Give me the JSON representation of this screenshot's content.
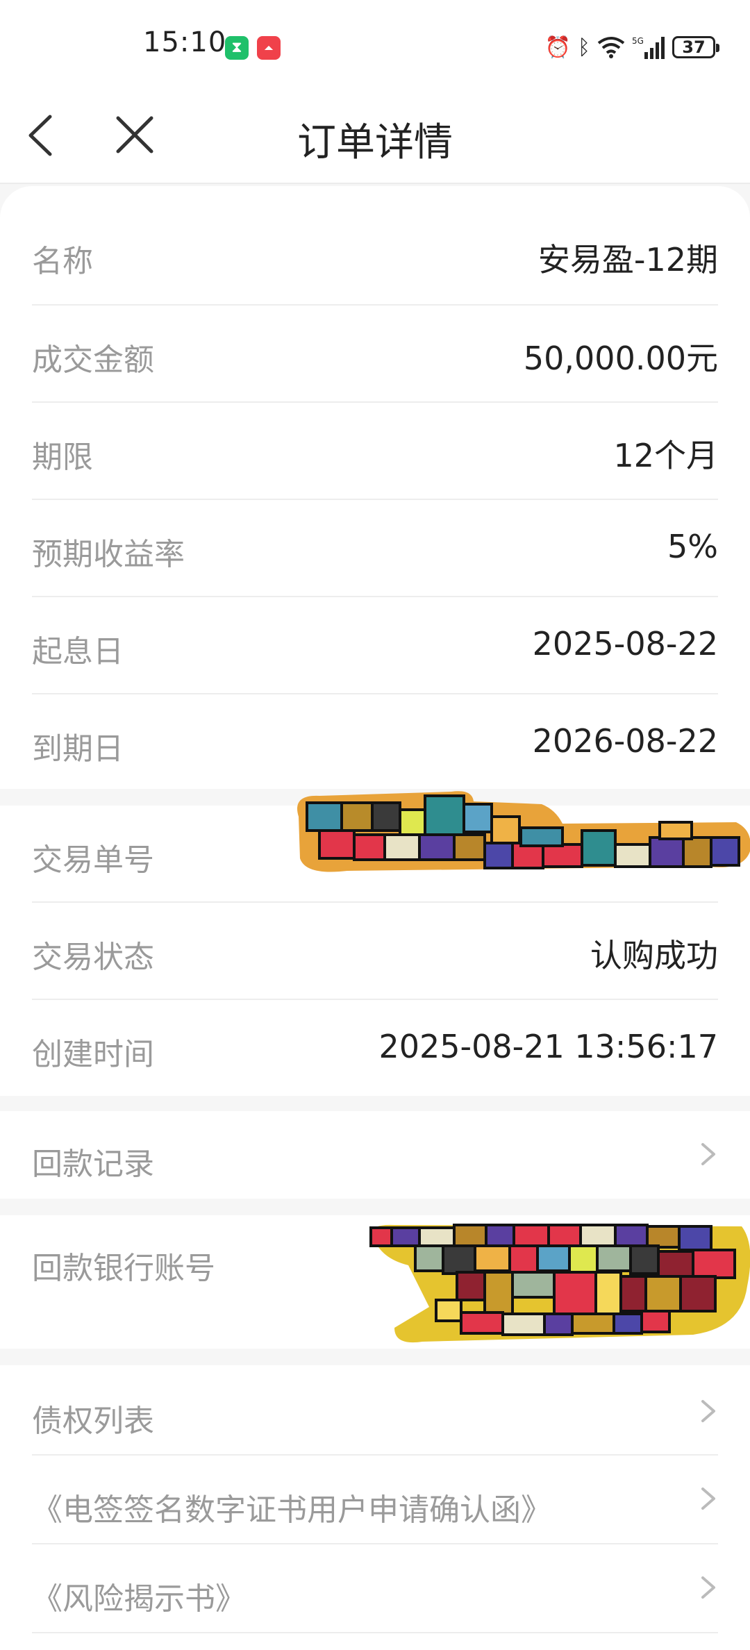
{
  "status_bar": {
    "time": "15:10",
    "battery": "37",
    "app_icon_1": "hourglass-icon",
    "app_icon_2": "huawei-app-icon",
    "icons": [
      "alarm-icon",
      "bluetooth-icon",
      "wifi-icon",
      "signal-5g-icon"
    ]
  },
  "nav": {
    "title": "订单详情",
    "back_icon": "chevron-left-icon",
    "close_icon": "close-icon"
  },
  "product_info": [
    {
      "label": "名称",
      "value": "安易盈-12期"
    },
    {
      "label": "成交金额",
      "value": "50,000.00元"
    },
    {
      "label": "期限",
      "value": "12个月"
    },
    {
      "label": "预期收益率",
      "value": "5%"
    },
    {
      "label": "起息日",
      "value": "2025-08-22"
    },
    {
      "label": "到期日",
      "value": "2026-08-22"
    }
  ],
  "transaction_info": [
    {
      "label": "交易单号",
      "value": ""
    },
    {
      "label": "交易状态",
      "value": "认购成功"
    },
    {
      "label": "创建时间",
      "value": "2025-08-21 13:56:17"
    }
  ],
  "repayment_record": {
    "label": "回款记录"
  },
  "repayment_account": {
    "label": "回款银行账号"
  },
  "documents": [
    {
      "label": "债权列表"
    },
    {
      "label": "《电签签名数字证书用户申请确认函》"
    },
    {
      "label": "《风险揭示书》"
    }
  ],
  "colors": {
    "background": "#f6f6f6",
    "card": "#ffffff",
    "label": "#9a9a9a",
    "value": "#222222",
    "divider": "#ededed"
  }
}
